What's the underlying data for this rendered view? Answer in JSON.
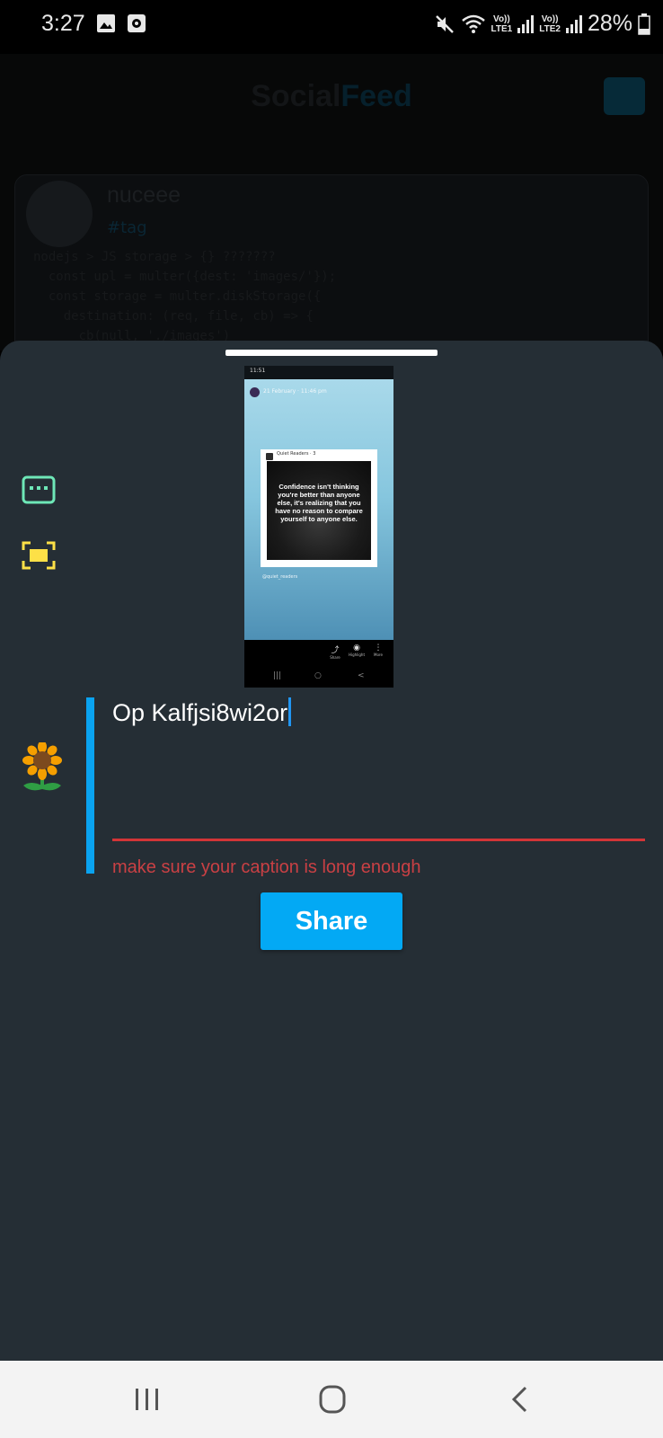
{
  "status_bar": {
    "time": "3:27",
    "icons": [
      "gallery-icon",
      "screen-record-icon",
      "mute-icon",
      "wifi-icon",
      "signal-icon"
    ],
    "sim1": {
      "top": "Vo))",
      "bottom": "LTE1"
    },
    "sim2": {
      "top": "Vo))",
      "bottom": "LTE2"
    },
    "battery_text": "28%",
    "battery_level": 0.28
  },
  "background_feed": {
    "title_part1": "Social",
    "title_part2": "Feed",
    "username": "nuceee",
    "tag": "#tag",
    "code_lines": [
      "nodejs > JS storage > {} ???????",
      "  const upl = multer({dest: 'images/'});",
      "  const storage = multer.diskStorage({",
      "    destination: (req, file, cb) => {",
      "      cb(null, './images')"
    ]
  },
  "sheet": {
    "preview": {
      "status_time": "11:51",
      "date": "21 February · 11:46 pm",
      "card_header": "Quiet Readers · 3",
      "quote": "Confidence isn't thinking you're better than anyone else, it's realizing that you have no reason to compare yourself to anyone else.",
      "handle": "@quiet_readers",
      "actions": [
        {
          "icon": "⤴",
          "label": "Share"
        },
        {
          "icon": "◉",
          "label": "Highlight"
        },
        {
          "icon": "⋮",
          "label": "More"
        }
      ],
      "nav": [
        "|||",
        "○",
        "<"
      ]
    },
    "caption": {
      "value": "Op Kalfjsi8wi2or",
      "error": "make sure your caption is long enough"
    },
    "share_label": "Share",
    "icons": {
      "text": "keyboard-icon",
      "image": "image-frame-icon",
      "caption": "sunflower-icon"
    },
    "colors": {
      "accent_blue": "#03a9f4",
      "error_red": "#d33537",
      "keyboard_green": "#6ee7b7",
      "frame_yellow": "#fde047"
    }
  },
  "nav_bar": {
    "buttons": [
      "recents-button",
      "home-button",
      "back-button"
    ]
  }
}
